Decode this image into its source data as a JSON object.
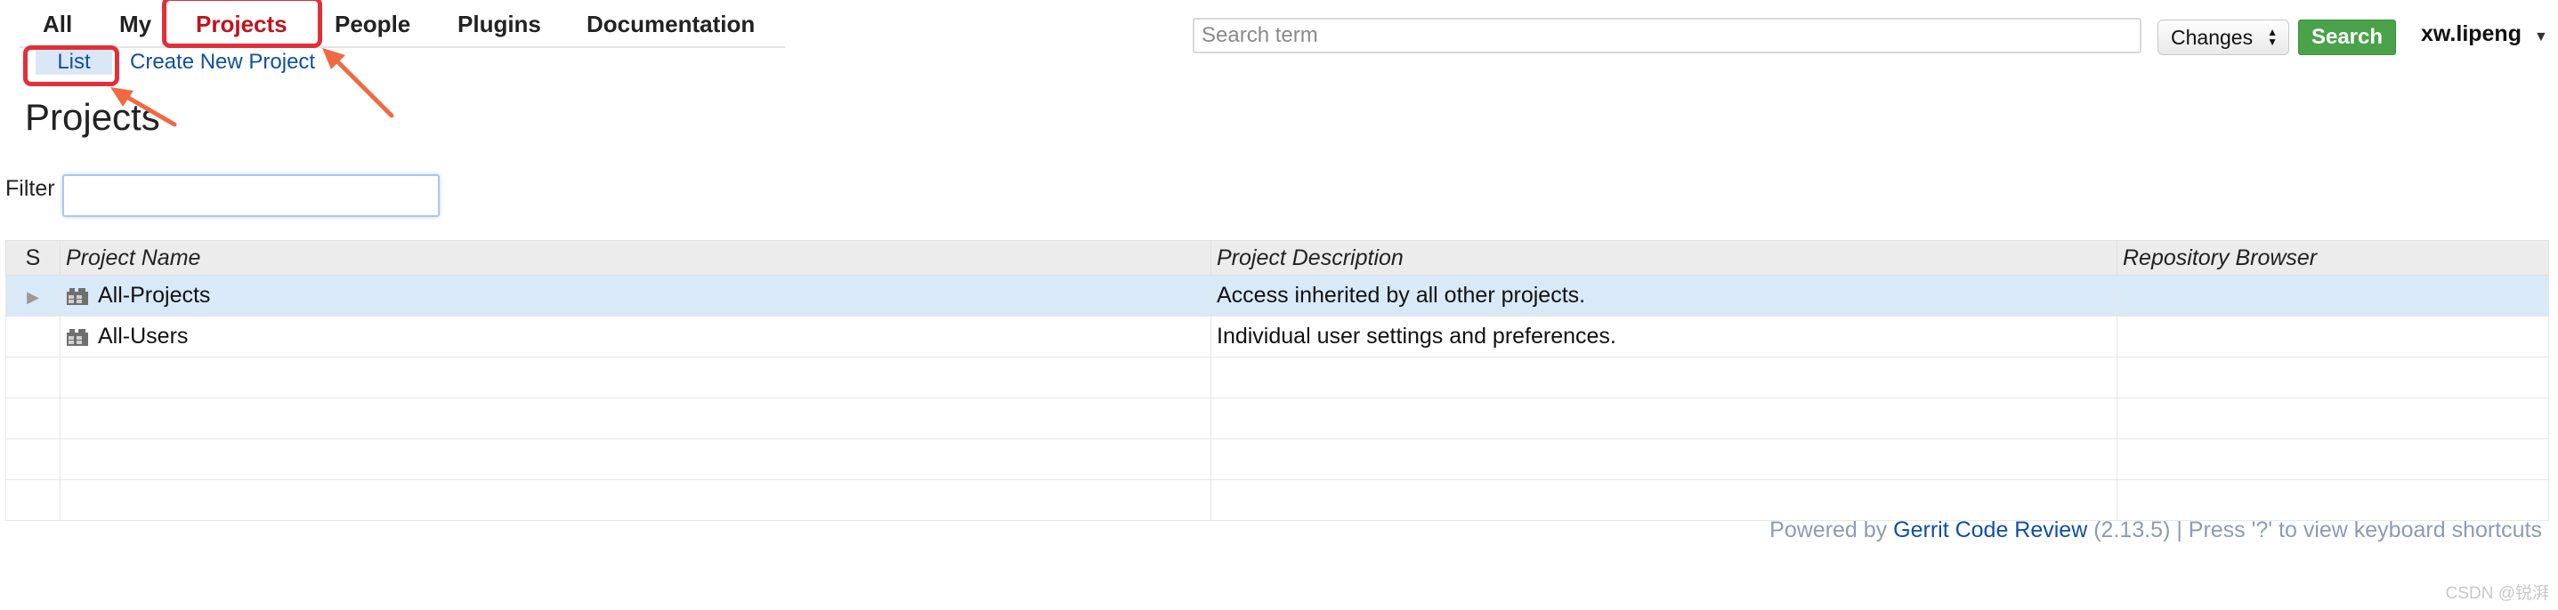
{
  "topmenu": {
    "tabs": [
      {
        "label": "All"
      },
      {
        "label": "My"
      },
      {
        "label": "Projects"
      },
      {
        "label": "People"
      },
      {
        "label": "Plugins"
      },
      {
        "label": "Documentation"
      }
    ],
    "active_color": "#c0141e"
  },
  "submenu": {
    "list_label": "List",
    "create_label": "Create New Project"
  },
  "search": {
    "placeholder": "Search term",
    "value": "",
    "scope_selected": "Changes",
    "button_label": "Search",
    "button_color": "#4aa24a"
  },
  "user": {
    "name": "xw.lipeng",
    "caret_icon": "caret-down-icon"
  },
  "page": {
    "title": "Projects"
  },
  "filter": {
    "label": "Filter",
    "value": ""
  },
  "table": {
    "headers": {
      "s": "S",
      "name": "Project Name",
      "description": "Project Description",
      "browser": "Repository Browser"
    },
    "rows": [
      {
        "name": "All-Projects",
        "description": "Access inherited by all other projects.",
        "browser": "",
        "selected": true,
        "icon": "project-icon"
      },
      {
        "name": "All-Users",
        "description": "Individual user settings and preferences.",
        "browser": "",
        "selected": false,
        "icon": "project-icon"
      }
    ]
  },
  "footer": {
    "powered_by": "Powered by",
    "product": "Gerrit Code Review",
    "version_text": "(2.13.5) | Press '?' to view keyboard shortcuts"
  },
  "watermark": "CSDN @锐湃",
  "annotation_color": "#e0303a"
}
